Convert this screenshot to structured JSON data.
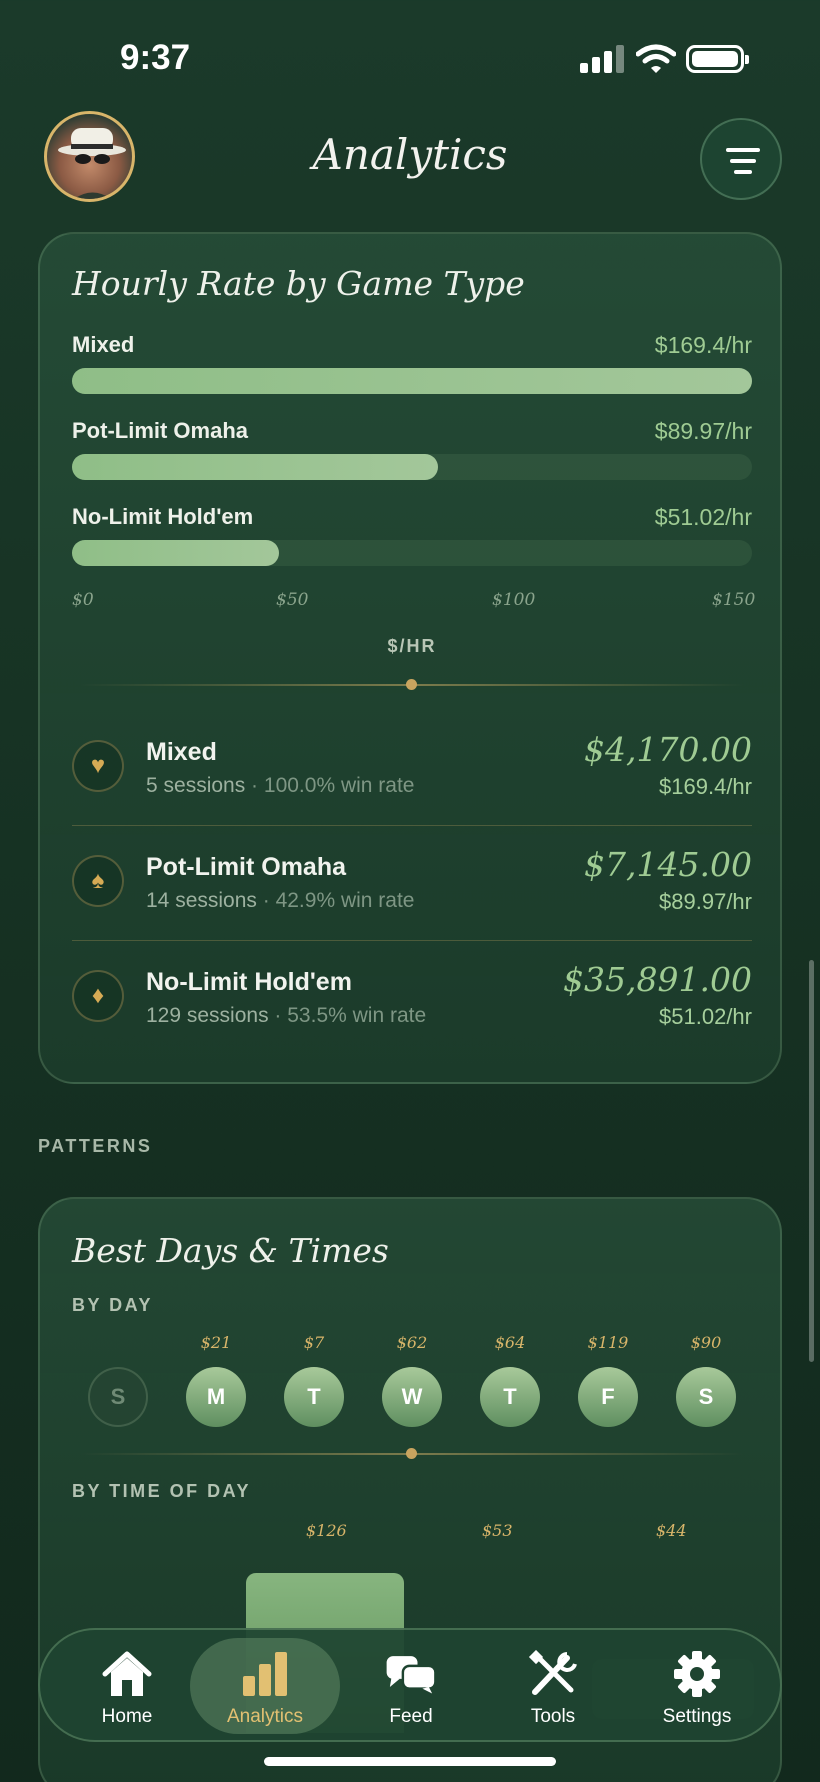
{
  "status_bar": {
    "time": "9:37"
  },
  "header": {
    "title": "Analytics"
  },
  "hourly_card": {
    "title": "Hourly Rate by Game Type",
    "axis_ticks": [
      "$0",
      "$50",
      "$100",
      "$150"
    ],
    "axis_label": "$/HR",
    "bars": [
      {
        "label": "Mixed",
        "value": "$169.4/hr",
        "rate": 169.4
      },
      {
        "label": "Pot-Limit Omaha",
        "value": "$89.97/hr",
        "rate": 89.97
      },
      {
        "label": "No-Limit Hold'em",
        "value": "$51.02/hr",
        "rate": 51.02
      }
    ],
    "games": [
      {
        "icon": "heart-icon",
        "name": "Mixed",
        "sessions": "5 sessions",
        "win_rate": "100.0% win rate",
        "total": "$4,170.00",
        "rate": "$169.4/hr"
      },
      {
        "icon": "spade-icon",
        "name": "Pot-Limit Omaha",
        "sessions": "14 sessions",
        "win_rate": "42.9% win rate",
        "total": "$7,145.00",
        "rate": "$89.97/hr"
      },
      {
        "icon": "diamond-icon",
        "name": "No-Limit Hold'em",
        "sessions": "129 sessions",
        "win_rate": "53.5% win rate",
        "total": "$35,891.00",
        "rate": "$51.02/hr"
      }
    ]
  },
  "patterns": {
    "section_label": "PATTERNS",
    "card_title": "Best Days & Times",
    "by_day_label": "BY DAY",
    "days": [
      {
        "letter": "S",
        "amount": ""
      },
      {
        "letter": "M",
        "amount": "$21"
      },
      {
        "letter": "T",
        "amount": "$7"
      },
      {
        "letter": "W",
        "amount": "$62"
      },
      {
        "letter": "T",
        "amount": "$64"
      },
      {
        "letter": "F",
        "amount": "$119"
      },
      {
        "letter": "S",
        "amount": "$90"
      }
    ],
    "by_time_label": "BY TIME OF DAY",
    "time_amounts": [
      "$126",
      "$53",
      "$44"
    ]
  },
  "tabbar": {
    "tabs": [
      {
        "label": "Home",
        "icon": "home-icon"
      },
      {
        "label": "Analytics",
        "icon": "bar-chart-icon",
        "active": true
      },
      {
        "label": "Feed",
        "icon": "chat-bubbles-icon"
      },
      {
        "label": "Tools",
        "icon": "tools-icon"
      },
      {
        "label": "Settings",
        "icon": "gear-icon"
      }
    ]
  },
  "colors": {
    "accent_gold": "#d8b56a",
    "accent_green": "#9fcb93",
    "background": "#173324"
  }
}
